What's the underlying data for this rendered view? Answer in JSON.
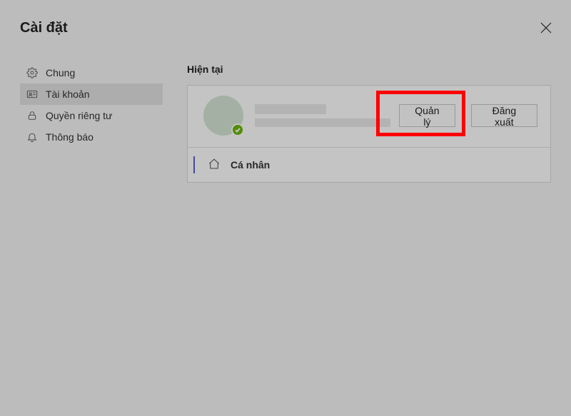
{
  "title": "Cài đặt",
  "sidebar": {
    "items": [
      {
        "label": "Chung"
      },
      {
        "label": "Tài khoản"
      },
      {
        "label": "Quyền riêng tư"
      },
      {
        "label": "Thông báo"
      }
    ]
  },
  "main": {
    "section_title": "Hiện tại",
    "account": {
      "manage_label": "Quản lý",
      "signout_label": "Đăng xuất"
    },
    "personal_label": "Cá nhân"
  }
}
